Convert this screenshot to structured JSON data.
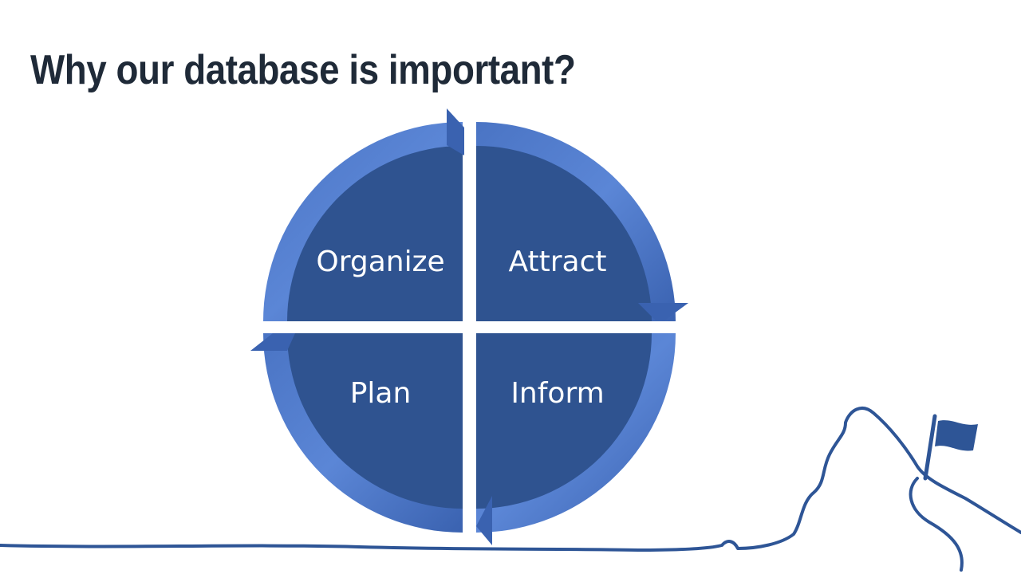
{
  "slide": {
    "title": "Why our database is important?"
  },
  "cycle": {
    "quadrants": [
      {
        "label": "Organize"
      },
      {
        "label": "Attract"
      },
      {
        "label": "Plan"
      },
      {
        "label": "Inform"
      }
    ]
  },
  "colors": {
    "title": "#1f2a38",
    "quadrant_fill": "#2f5390",
    "ring_light": "#5b86d6",
    "ring_dark": "#2b4c88",
    "line": "#2e5596"
  },
  "icons": [
    "flag-icon",
    "mountain-line"
  ]
}
